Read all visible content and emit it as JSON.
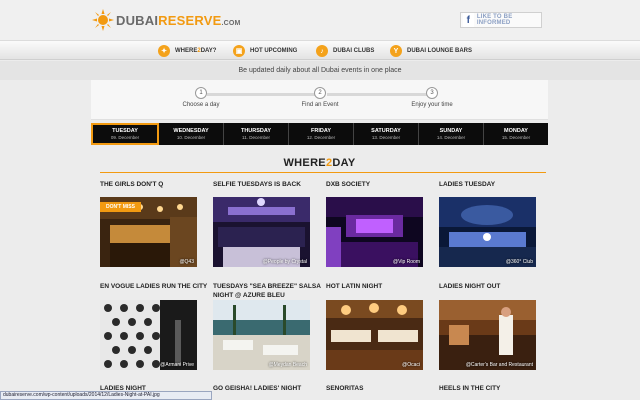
{
  "header": {
    "logo": {
      "part1": "DUBAI",
      "part2": "RESERVE",
      "part3": ".COM"
    },
    "like_label": "LIKE TO BE INFORMED",
    "fb_icon": "f"
  },
  "nav": [
    {
      "label_a": "WHERE",
      "label_b": "2",
      "label_c": "DAY?",
      "icon": "where2day-icon"
    },
    {
      "label_a": "HOT UPCOMING",
      "label_b": "",
      "label_c": "",
      "icon": "hot-icon"
    },
    {
      "label_a": "DUBAI CLUBS",
      "label_b": "",
      "label_c": "",
      "icon": "clubs-icon"
    },
    {
      "label_a": "DUBAI LOUNGE BARS",
      "label_b": "",
      "label_c": "",
      "icon": "cocktail-icon"
    }
  ],
  "tagline": "Be updated daily about all Dubai events in one place",
  "steps": [
    {
      "num": "1",
      "label": "Choose a day"
    },
    {
      "num": "2",
      "label": "Find an Event"
    },
    {
      "num": "3",
      "label": "Enjoy your time"
    }
  ],
  "days": [
    {
      "name": "TUESDAY",
      "date": "09. December"
    },
    {
      "name": "WEDNESDAY",
      "date": "10. December"
    },
    {
      "name": "THURSDAY",
      "date": "11. December"
    },
    {
      "name": "FRIDAY",
      "date": "12. December"
    },
    {
      "name": "SATURDAY",
      "date": "13. December"
    },
    {
      "name": "SUNDAY",
      "date": "14. December"
    },
    {
      "name": "MONDAY",
      "date": "15. December"
    }
  ],
  "section": {
    "a": "WHERE",
    "b": "2",
    "c": "DAY"
  },
  "events": [
    {
      "title": "THE GIRLS DON'T Q",
      "credit": "@Q43",
      "badge": "DON'T MISS"
    },
    {
      "title": "SELFIE TUESDAYS IS BACK",
      "credit": "@People by Crystal"
    },
    {
      "title": "DXB SOCIETY",
      "credit": "@Vip Room"
    },
    {
      "title": "LADIES TUESDAY",
      "credit": "@360° Club"
    },
    {
      "title": "EN VOGUE LADIES RUN THE CITY",
      "credit": "@Armani Prive"
    },
    {
      "title": "TUESDAYS \"SEA BREEZE\" SALSA NIGHT @ AZURE BLEU",
      "credit": "@Meydan Beach"
    },
    {
      "title": "HOT LATIN NIGHT",
      "credit": "@Ocaci"
    },
    {
      "title": "LADIES NIGHT OUT",
      "credit": "@Carter's Bar and Restaurant"
    },
    {
      "title": "LADIES NIGHT",
      "credit": ""
    },
    {
      "title": "GO GEISHA! LADIES' NIGHT",
      "credit": ""
    },
    {
      "title": "SENORITAS",
      "credit": ""
    },
    {
      "title": "HEELS IN THE CITY",
      "credit": ""
    }
  ],
  "status_url": "dubaireserve.com/wp-content/uploads/2014/12/Ladies-Night-at-PAI.jpg",
  "colors": {
    "accent": "#f29a11",
    "dark": "#0c0c0c"
  }
}
